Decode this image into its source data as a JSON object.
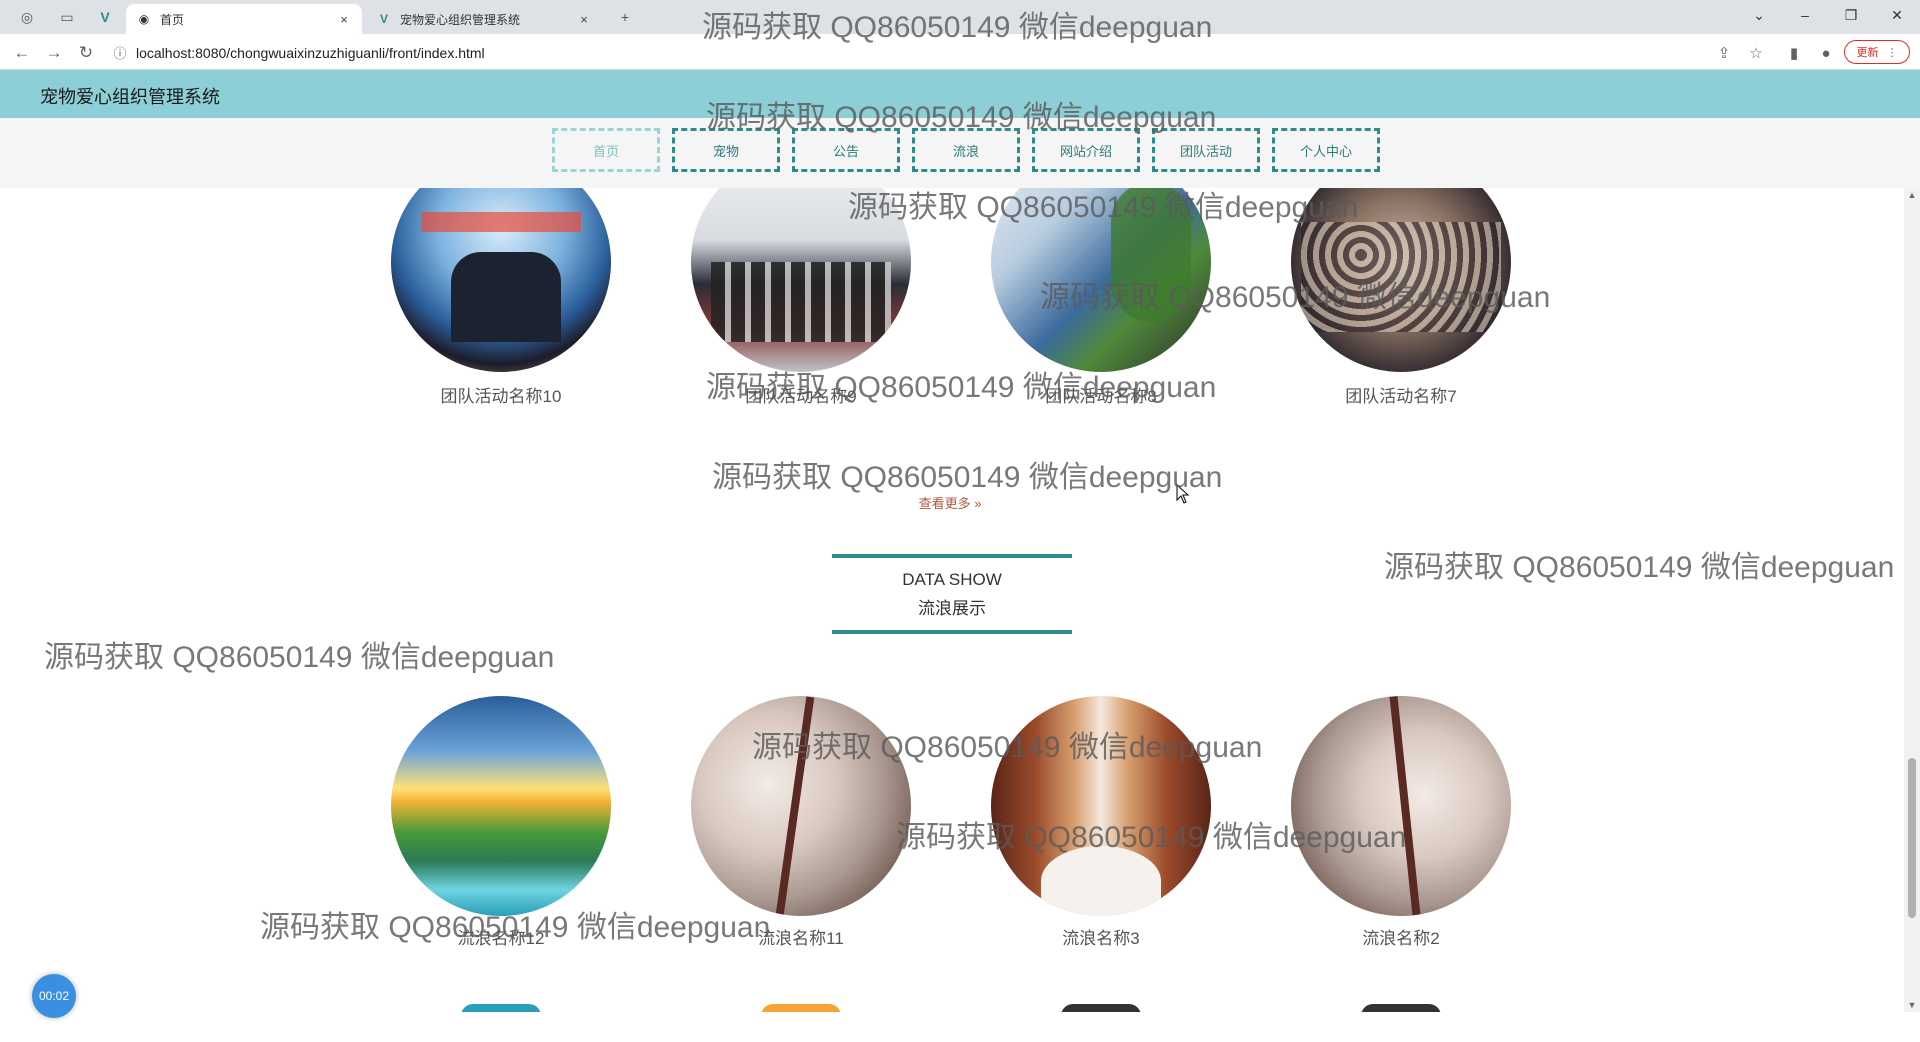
{
  "browser": {
    "tabs": [
      {
        "title": "首页",
        "close": "×"
      },
      {
        "title": "宠物爱心组织管理系统",
        "close": "×"
      }
    ],
    "new_tab": "+",
    "url": "localhost:8080/chongwuaixinzuzhiguanli/front/index.html",
    "update_label": "更新"
  },
  "site": {
    "title": "宠物爱心组织管理系统",
    "nav": [
      "首页",
      "宠物",
      "公告",
      "流浪",
      "网站介绍",
      "团队活动",
      "个人中心"
    ]
  },
  "activities": {
    "items": [
      {
        "name": "团队活动名称10"
      },
      {
        "name": "团队活动名称9"
      },
      {
        "name": "团队活动名称8"
      },
      {
        "name": "团队活动名称7"
      }
    ],
    "more_label": "查看更多 »"
  },
  "stray_section": {
    "title_en": "DATA SHOW",
    "title_zh": "流浪展示",
    "items": [
      {
        "name": "流浪名称12"
      },
      {
        "name": "流浪名称11"
      },
      {
        "name": "流浪名称3"
      },
      {
        "name": "流浪名称2"
      }
    ]
  },
  "timer": "00:02",
  "watermark": "源码获取 QQ86050149 微信deepguan",
  "colors": {
    "header": "#8ccfd6",
    "accent": "#2e8b8b",
    "nav_active": "#9ad4d4"
  }
}
